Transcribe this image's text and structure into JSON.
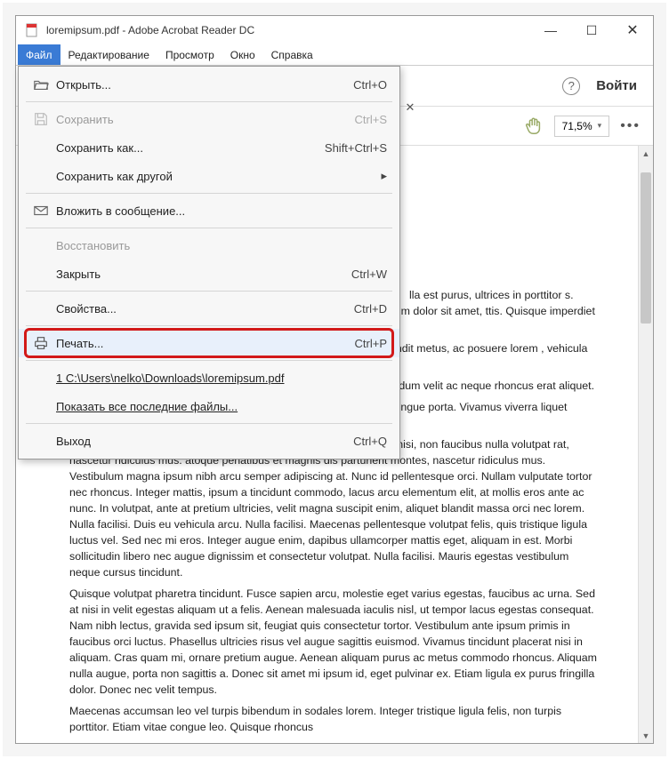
{
  "title": "loremipsum.pdf - Adobe Acrobat Reader DC",
  "menubar": [
    "Файл",
    "Редактирование",
    "Просмотр",
    "Окно",
    "Справка"
  ],
  "toolbar": {
    "signin": "Войти",
    "zoom": "71,5%"
  },
  "dropdown": {
    "open": {
      "label": "Открыть...",
      "shortcut": "Ctrl+O"
    },
    "save": {
      "label": "Сохранить",
      "shortcut": "Ctrl+S"
    },
    "save_as": {
      "label": "Сохранить как...",
      "shortcut": "Shift+Ctrl+S"
    },
    "save_as_other": {
      "label": "Сохранить как другой"
    },
    "attach": {
      "label": "Вложить в сообщение..."
    },
    "revert": {
      "label": "Восстановить"
    },
    "close": {
      "label": "Закрыть",
      "shortcut": "Ctrl+W"
    },
    "properties": {
      "label": "Свойства...",
      "shortcut": "Ctrl+D"
    },
    "print": {
      "label": "Печать...",
      "shortcut": "Ctrl+P"
    },
    "recent1": {
      "label": "1 C:\\Users\\nelko\\Downloads\\loremipsum.pdf"
    },
    "show_all_recent": {
      "label": "Показать все последние файлы..."
    },
    "exit": {
      "label": "Выход",
      "shortcut": "Ctrl+Q"
    }
  },
  "document": {
    "p1": "lla est purus, ultrices in porttitor s. Curabitur eget felis id feugiat t lorem. Aliquam porta eros sed m ipsum dolor sit amet, ttis. Quisque imperdiet ipsum vel stibulum turpis vitae viverra id.",
    "p2": "a blandit metus, ac posuere lorem , vehicula eu dui. Duis lacinia uere a purus. Nulla facilisi.",
    "p3": "bibendum velit ac neque rhoncus erat aliquet.",
    "p4": "ttis congue porta. Vivamus viverra liquet blandit quam nec dignissim.",
    "p5": "bero nisi, non faucibus nulla volutpat rat, nascetur ridiculus mus. atoque penatibus et magnis dis parturient montes, nascetur ridiculus mus. Vestibulum magna ipsum nibh arcu semper adipiscing at. Nunc id pellentesque orci. Nullam vulputate tortor nec rhoncus. Integer mattis, ipsum a tincidunt commodo, lacus arcu elementum elit, at mollis eros ante ac nunc. In volutpat, ante at pretium ultricies, velit magna suscipit enim, aliquet blandit massa orci nec lorem. Nulla facilisi. Duis eu vehicula arcu. Nulla facilisi. Maecenas pellentesque volutpat felis, quis tristique ligula luctus vel. Sed nec mi eros. Integer augue enim, dapibus ullamcorper mattis eget, aliquam in est. Morbi sollicitudin libero nec augue dignissim et consectetur volutpat. Nulla facilisi. Mauris egestas vestibulum neque cursus tincidunt.",
    "p6": "Quisque volutpat pharetra tincidunt. Fusce sapien arcu, molestie eget varius egestas, faucibus ac urna. Sed at nisi in velit egestas aliquam ut a felis. Aenean malesuada iaculis nisl, ut tempor lacus egestas consequat. Nam nibh lectus, gravida sed ipsum sit, feugiat quis consectetur tortor. Vestibulum ante ipsum primis in faucibus orci luctus. Phasellus ultricies risus vel augue sagittis euismod. Vivamus tincidunt placerat nisi in aliquam. Cras quam mi, ornare pretium augue. Aenean aliquam purus ac metus commodo rhoncus. Aliquam nulla augue, porta non sagittis a. Donec sit amet mi ipsum id, eget pulvinar ex. Etiam ligula ex purus fringilla dolor. Donec nec velit tempus.",
    "p7": "Maecenas accumsan leo vel turpis bibendum in sodales lorem. Integer tristique ligula felis, non turpis porttitor. Etiam vitae congue leo. Quisque rhoncus"
  }
}
